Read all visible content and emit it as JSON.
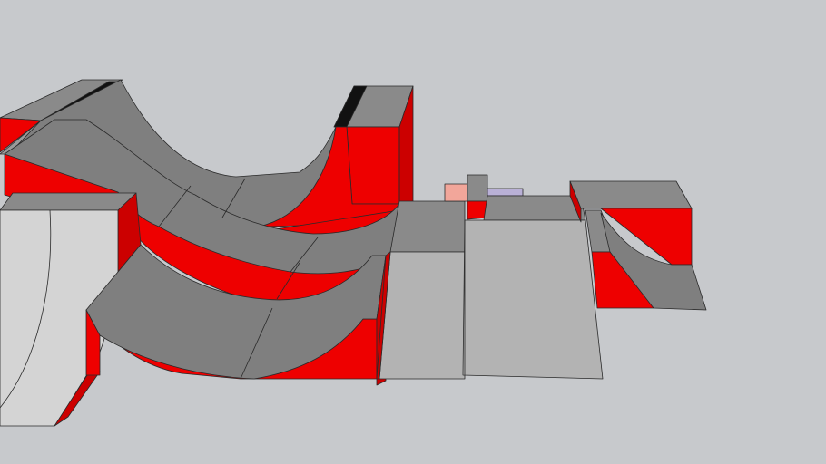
{
  "scene": {
    "description_hidden": "",
    "palette": {
      "background": "#c7c9cc",
      "ramp_red": "#ee0000",
      "ramp_red_dark": "#cc0000",
      "deck_gray": "#8a8a8a",
      "curve_gray": "#7f7f7f",
      "curve_gray_light": "#9a9a9a",
      "flat_light": "#b3b3b3",
      "flat_lighter": "#d4d4d4",
      "coping_black": "#111111",
      "accent_pink": "#f2a69a",
      "accent_lavender": "#b9b0d6"
    }
  }
}
